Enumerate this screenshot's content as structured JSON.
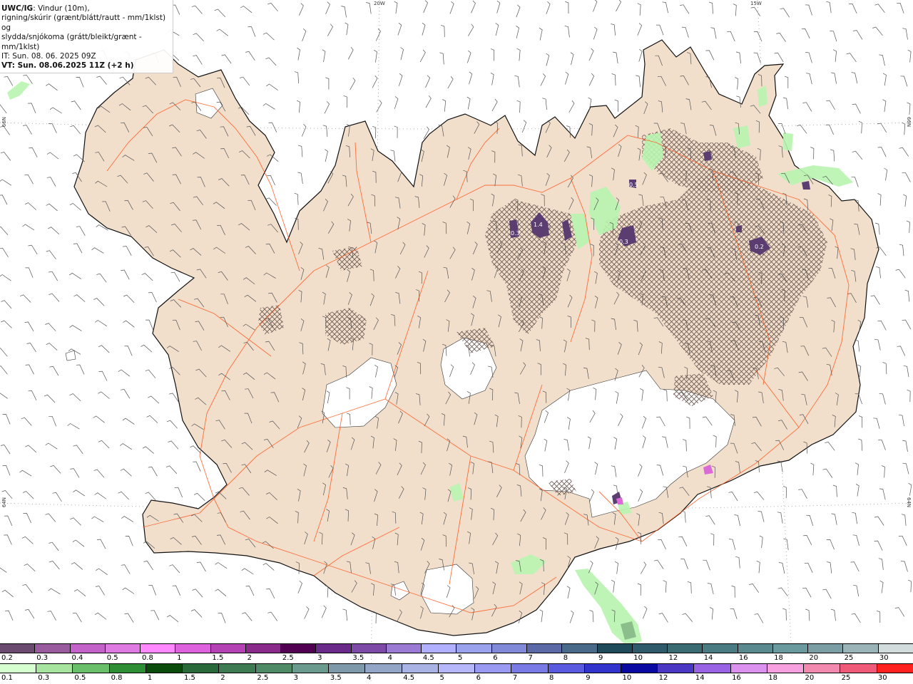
{
  "header": {
    "model": "UWC/IG",
    "line1_rest": ": Vindur (10m),",
    "line2": "rigning/skúrir (grænt/blátt/rautt - mm/1klst) og",
    "line3": "slydda/snjókoma (grátt/bleikt/grænt - mm/1klst)",
    "line4": "IT: Sun. 08. 06. 2025 09Z",
    "line5": "VT: Sun. 08.06.2025 11Z (+2 h)"
  },
  "coords": {
    "lon_20w": "20W",
    "lon_15w": "15W",
    "lat_66n_left": "66N",
    "lat_66n_right": "66N",
    "lat_64n_left": "64N",
    "lat_64n_right": "64N"
  },
  "map_labels": {
    "val_a": "1.4",
    "val_b": "0.2",
    "val_c": "0.3",
    "val_d": "0.5",
    "val_e": "0.3"
  },
  "colors": {
    "land": "#f1dfcc",
    "glacier": "#ffffff",
    "roads": "#ff5a1f",
    "coastline": "#111111",
    "snow_hatch": "#6b5650",
    "rain_green": "#b8f5b0",
    "snow_purple": "#5b3d72",
    "sleet_magenta": "#d96ad8"
  },
  "legend_snow": {
    "labels": [
      "0.2",
      "0.3",
      "0.4",
      "0.5",
      "0.8",
      "1",
      "1.5",
      "2",
      "2.5",
      "3",
      "3.5",
      "4",
      "4.5",
      "5",
      "6",
      "7",
      "8",
      "9",
      "10",
      "12",
      "14",
      "16",
      "18",
      "20",
      "25",
      "30"
    ],
    "colors": [
      "#6a4a6e",
      "#9a5a9e",
      "#c363c9",
      "#e07ae3",
      "#ff88ff",
      "#de62dd",
      "#b442b4",
      "#8a2a8a",
      "#520052",
      "#6a2a8a",
      "#7d4aa8",
      "#9a7ad2",
      "#b0b0ff",
      "#9aa2ee",
      "#808ad8",
      "#5b6aa6",
      "#4a6a8a",
      "#1e4a5a",
      "#2e5a6a",
      "#3a6a72",
      "#4a7a82",
      "#5a8a90",
      "#6a9a9e",
      "#7a9ea4",
      "#9ab4b8",
      "#d2dcdc"
    ]
  },
  "legend_rain": {
    "labels": [
      "0.1",
      "0.3",
      "0.5",
      "0.8",
      "1",
      "1.5",
      "2",
      "2.5",
      "3",
      "3.5",
      "4",
      "4.5",
      "5",
      "6",
      "7",
      "8",
      "9",
      "10",
      "12",
      "14",
      "16",
      "18",
      "20",
      "25",
      "30"
    ],
    "colors": [
      "#d6ffd0",
      "#a6e4a0",
      "#6ac06a",
      "#2e8e36",
      "#0a4a0a",
      "#2a6a3a",
      "#3e7a52",
      "#4e8a66",
      "#6a9a8e",
      "#7e9aaa",
      "#94a6c8",
      "#aab4e4",
      "#b6b6fa",
      "#9a9af2",
      "#7a7ae6",
      "#5a5ae0",
      "#3232cc",
      "#0a0aa2",
      "#4a38c4",
      "#9a62e4",
      "#da92ee",
      "#f6a0e0",
      "#f28ab0",
      "#ee5a78",
      "#ff2020"
    ]
  }
}
